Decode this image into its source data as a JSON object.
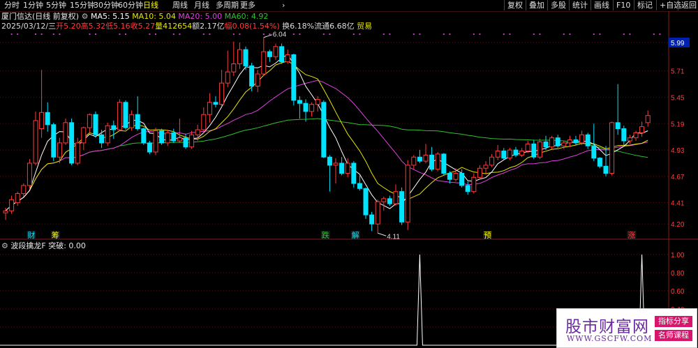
{
  "toolbar": {
    "left": [
      "分时",
      "1分钟",
      "5分钟",
      "15分钟",
      "30分钟",
      "60分钟",
      "日线",
      "周线",
      "月线",
      "多周期",
      "更多"
    ],
    "active": "日线",
    "right": [
      "复权",
      "叠加",
      "多股",
      "统计",
      "画线",
      "F10",
      "标记",
      "+自选",
      "返回"
    ]
  },
  "header": {
    "name": "厦门信达(日线 前复权)",
    "ma5": "MA5: 5.15",
    "ma10": "MA10: 5.04",
    "ma20": "MA20: 5.00",
    "ma60": "MA60: 4.92",
    "date": "2025/03/12/三",
    "open": "开5.20",
    "high": "高5.32",
    "low": "低5.16",
    "close": "收5.27",
    "vol": "量412654",
    "amount": "额2.17亿",
    "change": "幅0.08(1.54%)",
    "turnover": "换6.18%",
    "float": "流通6.68亿",
    "sector": "贸易"
  },
  "indicator": {
    "title": "波段擒龙F",
    "value": "突破: 0.00"
  },
  "colors": {
    "up": "#ff3b3b",
    "down": "#00e4ff",
    "ma5": "#ffffff",
    "ma10": "#e6e600",
    "ma20": "#e040e0",
    "ma60": "#30c030",
    "bg": "#000000"
  },
  "chart_data": {
    "type": "candlestick",
    "ylim": [
      4.05,
      6.1
    ],
    "yticks": [
      "5.99",
      "5.71",
      "5.45",
      "5.19",
      "4.93",
      "4.67",
      "4.41",
      "4.20"
    ],
    "price_label": "5.99",
    "max_label": "6.04",
    "min_label": "4.11",
    "candles": [
      [
        4.31,
        4.36,
        4.24,
        4.33
      ],
      [
        4.33,
        4.48,
        4.3,
        4.44
      ],
      [
        4.41,
        4.52,
        4.38,
        4.5
      ],
      [
        4.5,
        4.6,
        4.47,
        4.58
      ],
      [
        4.58,
        4.84,
        4.55,
        4.8
      ],
      [
        4.8,
        5.31,
        4.78,
        5.22
      ],
      [
        5.14,
        5.72,
        5.05,
        5.3
      ],
      [
        5.3,
        5.4,
        5.11,
        5.18
      ],
      [
        5.18,
        5.2,
        4.82,
        4.86
      ],
      [
        4.86,
        5.05,
        4.8,
        5.0
      ],
      [
        5.0,
        5.24,
        4.98,
        5.2
      ],
      [
        5.2,
        5.24,
        4.78,
        4.8
      ],
      [
        4.8,
        5.05,
        4.78,
        5.0
      ],
      [
        5.0,
        5.16,
        4.93,
        5.15
      ],
      [
        5.15,
        5.29,
        5.1,
        5.28
      ],
      [
        5.28,
        5.31,
        5.05,
        5.08
      ],
      [
        5.08,
        5.13,
        4.95,
        5.0
      ],
      [
        5.0,
        5.2,
        4.97,
        5.17
      ],
      [
        5.17,
        5.22,
        5.04,
        5.13
      ],
      [
        5.13,
        5.43,
        5.12,
        5.4
      ],
      [
        5.4,
        5.42,
        5.13,
        5.15
      ],
      [
        5.15,
        5.32,
        5.12,
        5.28
      ],
      [
        5.28,
        5.46,
        5.12,
        5.14
      ],
      [
        5.14,
        5.15,
        4.98,
        5.0
      ],
      [
        5.0,
        5.02,
        4.89,
        4.91
      ],
      [
        4.91,
        5.15,
        4.88,
        5.12
      ],
      [
        5.12,
        5.14,
        4.98,
        5.0
      ],
      [
        5.0,
        5.13,
        4.97,
        5.1
      ],
      [
        5.1,
        5.14,
        5.0,
        5.02
      ],
      [
        5.02,
        5.24,
        5.0,
        5.05
      ],
      [
        5.05,
        5.09,
        4.94,
        4.96
      ],
      [
        4.96,
        5.12,
        4.94,
        5.08
      ],
      [
        5.08,
        5.18,
        5.02,
        5.13
      ],
      [
        5.13,
        5.35,
        5.1,
        5.28
      ],
      [
        5.28,
        5.49,
        5.2,
        5.4
      ],
      [
        5.4,
        5.46,
        5.35,
        5.38
      ],
      [
        5.38,
        5.72,
        5.36,
        5.59
      ],
      [
        5.59,
        5.91,
        5.55,
        5.7
      ],
      [
        5.7,
        6.0,
        5.66,
        5.78
      ],
      [
        5.78,
        5.99,
        5.73,
        5.92
      ],
      [
        5.92,
        5.95,
        5.72,
        5.76
      ],
      [
        5.76,
        5.79,
        5.51,
        5.56
      ],
      [
        5.56,
        5.72,
        5.5,
        5.68
      ],
      [
        5.68,
        6.04,
        5.66,
        5.9
      ],
      [
        5.9,
        5.92,
        5.8,
        5.85
      ],
      [
        5.85,
        5.98,
        5.82,
        5.95
      ],
      [
        5.95,
        5.98,
        5.78,
        5.8
      ],
      [
        5.8,
        5.92,
        5.78,
        5.87
      ],
      [
        5.87,
        5.88,
        5.37,
        5.42
      ],
      [
        5.42,
        5.46,
        5.24,
        5.39
      ],
      [
        5.39,
        5.43,
        5.21,
        5.31
      ],
      [
        5.31,
        5.4,
        5.26,
        5.38
      ],
      [
        5.38,
        5.46,
        5.31,
        5.43
      ],
      [
        5.4,
        5.42,
        4.85,
        4.86
      ],
      [
        4.86,
        4.88,
        4.52,
        4.78
      ],
      [
        4.78,
        4.85,
        4.6,
        4.8
      ],
      [
        4.8,
        4.86,
        4.68,
        4.7
      ],
      [
        4.7,
        4.85,
        4.66,
        4.8
      ],
      [
        4.8,
        4.82,
        4.56,
        4.6
      ],
      [
        4.6,
        4.68,
        4.53,
        4.55
      ],
      [
        4.55,
        4.56,
        4.25,
        4.29
      ],
      [
        4.29,
        4.32,
        4.13,
        4.2
      ],
      [
        4.2,
        4.44,
        4.11,
        4.42
      ],
      [
        4.42,
        4.47,
        4.33,
        4.45
      ],
      [
        4.45,
        4.48,
        4.38,
        4.4
      ],
      [
        4.4,
        4.59,
        4.38,
        4.52
      ],
      [
        4.52,
        4.56,
        4.19,
        4.22
      ],
      [
        4.22,
        4.83,
        4.14,
        4.78
      ],
      [
        4.78,
        4.88,
        4.74,
        4.86
      ],
      [
        4.86,
        4.93,
        4.8,
        4.82
      ],
      [
        4.82,
        4.99,
        4.8,
        4.88
      ],
      [
        4.88,
        4.96,
        4.72,
        4.74
      ],
      [
        4.74,
        4.91,
        4.72,
        4.89
      ],
      [
        4.89,
        4.9,
        4.68,
        4.7
      ],
      [
        4.7,
        4.72,
        4.6,
        4.64
      ],
      [
        4.64,
        4.75,
        4.62,
        4.7
      ],
      [
        4.7,
        4.74,
        4.56,
        4.58
      ],
      [
        4.58,
        4.62,
        4.49,
        4.52
      ],
      [
        4.52,
        4.7,
        4.5,
        4.66
      ],
      [
        4.66,
        4.78,
        4.64,
        4.75
      ],
      [
        4.75,
        4.82,
        4.7,
        4.78
      ],
      [
        4.78,
        4.89,
        4.76,
        4.86
      ],
      [
        4.86,
        4.98,
        4.83,
        4.92
      ],
      [
        4.92,
        4.95,
        4.83,
        4.85
      ],
      [
        4.85,
        4.95,
        4.83,
        4.93
      ],
      [
        4.93,
        4.96,
        4.86,
        4.88
      ],
      [
        4.88,
        4.95,
        4.86,
        4.92
      ],
      [
        4.92,
        5.02,
        4.9,
        4.99
      ],
      [
        4.99,
        5.03,
        4.84,
        4.86
      ],
      [
        4.86,
        5.04,
        4.84,
        5.01
      ],
      [
        5.01,
        5.07,
        4.93,
        4.96
      ],
      [
        4.96,
        5.07,
        4.94,
        5.05
      ],
      [
        5.05,
        5.08,
        4.95,
        4.97
      ],
      [
        4.97,
        5.02,
        4.94,
        5.0
      ],
      [
        5.0,
        5.07,
        4.96,
        5.03
      ],
      [
        5.03,
        5.07,
        4.98,
        5.0
      ],
      [
        5.0,
        5.12,
        4.98,
        5.08
      ],
      [
        5.08,
        5.1,
        4.94,
        4.97
      ],
      [
        4.97,
        5.19,
        4.82,
        4.85
      ],
      [
        4.85,
        4.86,
        4.75,
        4.77
      ],
      [
        4.77,
        4.97,
        4.67,
        4.7
      ],
      [
        4.7,
        5.21,
        4.68,
        5.2
      ],
      [
        5.2,
        5.58,
        5.08,
        5.14
      ],
      [
        5.14,
        5.17,
        4.98,
        5.02
      ],
      [
        5.02,
        5.08,
        4.99,
        5.05
      ],
      [
        5.05,
        5.12,
        5.02,
        5.1
      ],
      [
        5.1,
        5.21,
        5.06,
        5.16
      ],
      [
        5.2,
        5.32,
        5.16,
        5.27
      ]
    ],
    "markers": [
      {
        "label": "财",
        "index": 4,
        "color": "#00e4ff"
      },
      {
        "label": "筹",
        "index": 8,
        "color": "#ffff00"
      },
      {
        "label": "跌",
        "index": 53,
        "color": "#30c030"
      },
      {
        "label": "解",
        "index": 58,
        "color": "#00e4ff"
      },
      {
        "label": "预",
        "index": 80,
        "color": "#ffff00"
      },
      {
        "label": "涨",
        "index": 104,
        "color": "#ff3b3b"
      }
    ],
    "indicator": {
      "yticks": [
        "1.00",
        "0.80",
        "0.60",
        "0.40",
        "0.20"
      ],
      "ylim": [
        0,
        1.0
      ],
      "spikes": [
        69,
        106
      ]
    }
  }
}
